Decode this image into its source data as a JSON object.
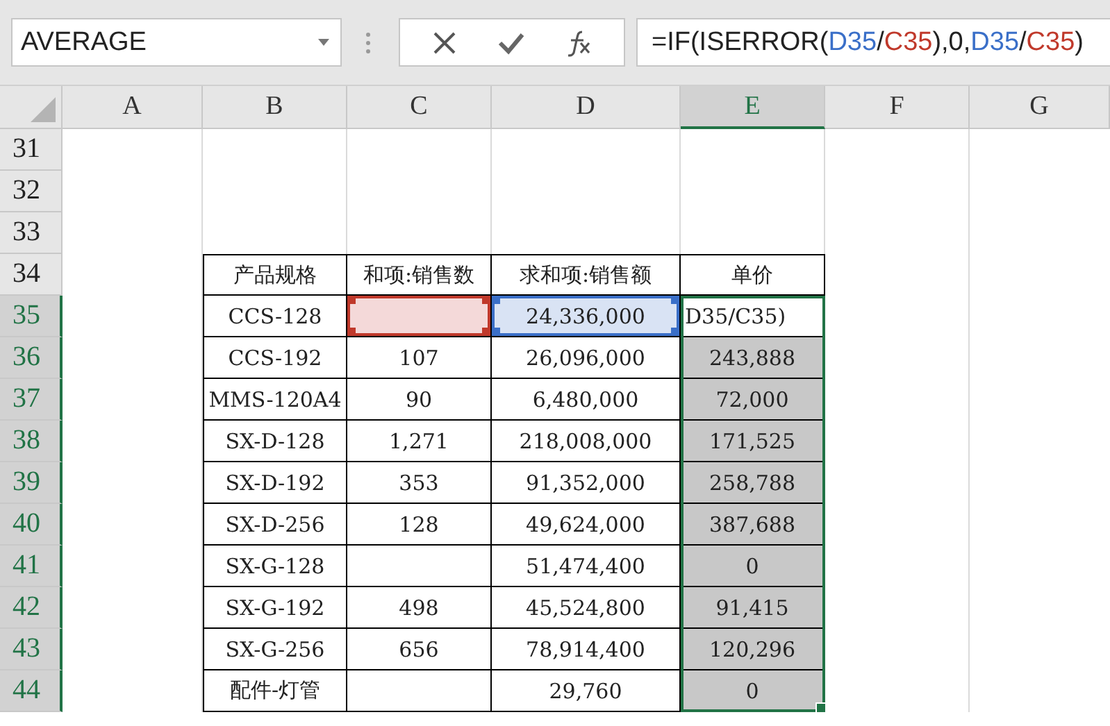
{
  "name_box": {
    "value": "AVERAGE"
  },
  "formula": [
    {
      "kind": "plain",
      "text": "=IF(ISERROR("
    },
    {
      "kind": "ref1",
      "text": "D35"
    },
    {
      "kind": "plain",
      "text": "/"
    },
    {
      "kind": "ref2",
      "text": "C35"
    },
    {
      "kind": "plain",
      "text": "),0,"
    },
    {
      "kind": "ref1",
      "text": "D35"
    },
    {
      "kind": "plain",
      "text": "/"
    },
    {
      "kind": "ref2",
      "text": "C35"
    },
    {
      "kind": "plain",
      "text": ")"
    }
  ],
  "columns": [
    {
      "label": "A",
      "selected": false
    },
    {
      "label": "B",
      "selected": false
    },
    {
      "label": "C",
      "selected": false
    },
    {
      "label": "D",
      "selected": false
    },
    {
      "label": "E",
      "selected": true
    },
    {
      "label": "F",
      "selected": false
    },
    {
      "label": "G",
      "selected": false
    }
  ],
  "rows": [
    {
      "number": "31",
      "selected": false,
      "kind": "blank"
    },
    {
      "number": "32",
      "selected": false,
      "kind": "blank"
    },
    {
      "number": "33",
      "selected": false,
      "kind": "blank"
    },
    {
      "number": "34",
      "selected": false,
      "kind": "header",
      "spec": "产品规格",
      "qty": "和项:销售数",
      "amount": "求和项:销售额",
      "price": "单价"
    },
    {
      "number": "35",
      "selected": true,
      "kind": "data",
      "spec": "CCS-128",
      "amount": "24,336,000",
      "price": "D35/C35)",
      "editing": true,
      "qty_ref": true,
      "amount_ref": true
    },
    {
      "number": "36",
      "selected": true,
      "kind": "data",
      "spec": "CCS-192",
      "qty": "107",
      "amount": "26,096,000",
      "price": "243,888"
    },
    {
      "number": "37",
      "selected": true,
      "kind": "data",
      "spec": "MMS-120A4",
      "qty": "90",
      "amount": "6,480,000",
      "price": "72,000"
    },
    {
      "number": "38",
      "selected": true,
      "kind": "data",
      "spec": "SX-D-128",
      "qty": "1,271",
      "amount": "218,008,000",
      "price": "171,525"
    },
    {
      "number": "39",
      "selected": true,
      "kind": "data",
      "spec": "SX-D-192",
      "qty": "353",
      "amount": "91,352,000",
      "price": "258,788"
    },
    {
      "number": "40",
      "selected": true,
      "kind": "data",
      "spec": "SX-D-256",
      "qty": "128",
      "amount": "49,624,000",
      "price": "387,688"
    },
    {
      "number": "41",
      "selected": true,
      "kind": "data",
      "spec": "SX-G-128",
      "amount": "51,474,400",
      "price": "0"
    },
    {
      "number": "42",
      "selected": true,
      "kind": "data",
      "spec": "SX-G-192",
      "qty": "498",
      "amount": "45,524,800",
      "price": "91,415"
    },
    {
      "number": "43",
      "selected": true,
      "kind": "data",
      "spec": "SX-G-256",
      "qty": "656",
      "amount": "78,914,400",
      "price": "120,296"
    },
    {
      "number": "44",
      "selected": true,
      "kind": "data",
      "spec": "配件-灯管",
      "amount": "29,760",
      "price": "0"
    }
  ]
}
